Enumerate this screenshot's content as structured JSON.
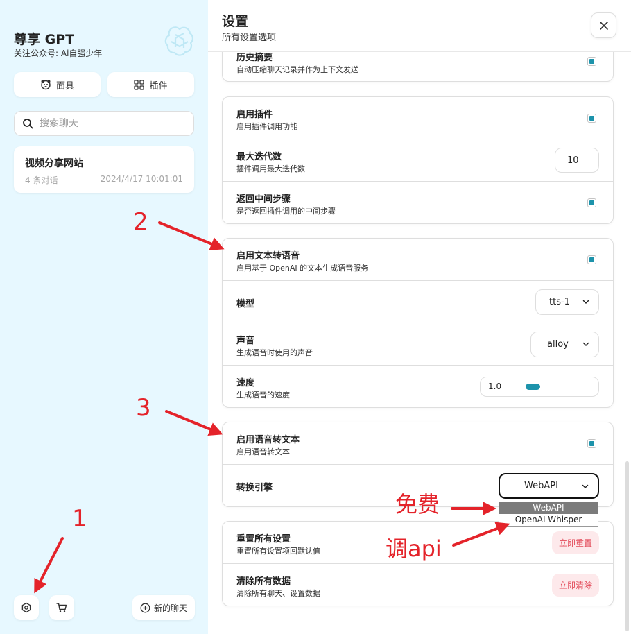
{
  "sidebar": {
    "title": "尊享 GPT",
    "subtitle": "关注公众号: Ai自强少年",
    "logo_icon": "openai-logo-icon",
    "mask_button": "面具",
    "plugin_button": "插件",
    "search_placeholder": "搜索聊天",
    "chats": [
      {
        "title": "视频分享网站",
        "count": "4 条对话",
        "time": "2024/4/17 10:01:01"
      }
    ],
    "new_chat": "新的聊天"
  },
  "settings": {
    "title": "设置",
    "subtitle": "所有设置选项",
    "history": {
      "title": "历史摘要",
      "sub": "自动压缩聊天记录并作为上下文发送",
      "checked": true
    },
    "plugins": {
      "enable": {
        "title": "启用插件",
        "sub": "启用插件调用功能",
        "checked": true
      },
      "max_iter": {
        "title": "最大迭代数",
        "sub": "插件调用最大迭代数",
        "value": "10"
      },
      "return_steps": {
        "title": "返回中间步骤",
        "sub": "是否返回插件调用的中间步骤",
        "checked": true
      }
    },
    "tts": {
      "enable": {
        "title": "启用文本转语音",
        "sub": "启用基于 OpenAI 的文本生成语音服务",
        "checked": true
      },
      "model": {
        "title": "模型",
        "value": "tts-1"
      },
      "voice": {
        "title": "声音",
        "sub": "生成语音时使用的声音",
        "value": "alloy"
      },
      "speed": {
        "title": "速度",
        "sub": "生成语音的速度",
        "value": "1.0"
      }
    },
    "stt": {
      "enable": {
        "title": "启用语音转文本",
        "sub": "启用语音转文本",
        "checked": true
      },
      "engine": {
        "title": "转换引擎",
        "value": "WebAPI",
        "options": [
          "WebAPI",
          "OpenAI Whisper"
        ]
      }
    },
    "danger": {
      "reset": {
        "title": "重置所有设置",
        "sub": "重置所有设置项回默认值",
        "button": "立即重置"
      },
      "clear": {
        "title": "清除所有数据",
        "sub": "清除所有聊天、设置数据",
        "button": "立即清除"
      }
    }
  },
  "annotations": {
    "n1": "1",
    "n2": "2",
    "n3": "3",
    "free": "免费",
    "api": "调api",
    "color": "#e4232a"
  }
}
